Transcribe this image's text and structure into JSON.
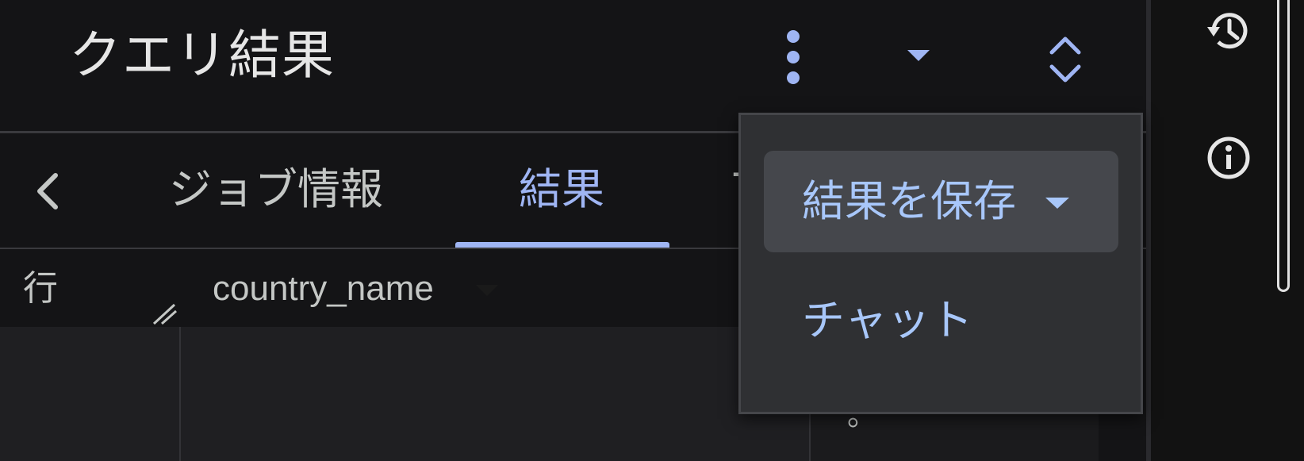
{
  "panel": {
    "title": "クエリ結果"
  },
  "tabs": [
    {
      "label": "ジョブ情報",
      "active": false
    },
    {
      "label": "結果",
      "active": true
    },
    {
      "label": "T",
      "active": false
    }
  ],
  "table": {
    "row_header": "行",
    "columns": [
      "country_name"
    ],
    "partial_cell_text": "。"
  },
  "menu": {
    "items": [
      {
        "label": "結果を保存",
        "has_submenu": true,
        "highlighted": true
      },
      {
        "label": "チャット",
        "has_submenu": false,
        "highlighted": false
      }
    ]
  },
  "icons": {
    "more": "more-vert-icon",
    "dropdown": "arrow-drop-down-icon",
    "expand": "unfold-more-icon",
    "back": "chevron-left-icon",
    "history": "history-icon",
    "info": "info-icon",
    "sort": "arrow-drop-down-icon"
  },
  "colors": {
    "accent": "#9fb5f3",
    "menu_text": "#a8c7fa",
    "background": "#141416",
    "menu_bg": "#2f3033"
  }
}
